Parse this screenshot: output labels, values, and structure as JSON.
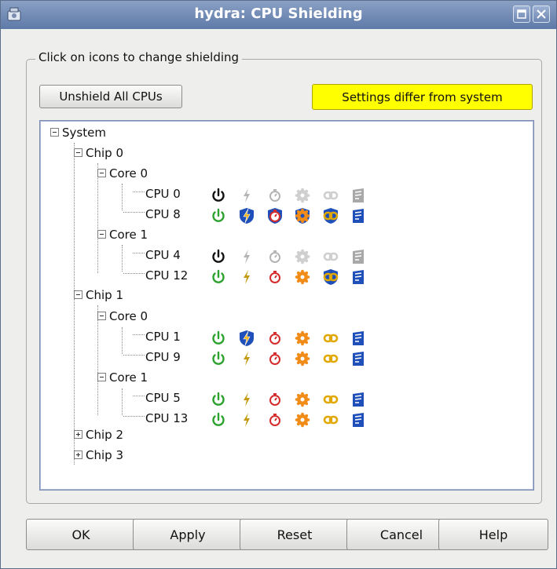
{
  "window": {
    "title": "hydra: CPU Shielding"
  },
  "group": {
    "legend": "Click on icons to change shielding",
    "unshield_label": "Unshield All CPUs",
    "status_text": "Settings differ from system"
  },
  "tree": {
    "root": "System",
    "chips": [
      {
        "label": "Chip 0",
        "cores": [
          {
            "label": "Core 0",
            "cpus": [
              {
                "label": "CPU 0",
                "state": "off"
              },
              {
                "label": "CPU 8",
                "state": "shielded-partial"
              }
            ]
          },
          {
            "label": "Core 1",
            "cpus": [
              {
                "label": "CPU 4",
                "state": "off"
              },
              {
                "label": "CPU 12",
                "state": "active-link-shielded"
              }
            ]
          }
        ]
      },
      {
        "label": "Chip 1",
        "cores": [
          {
            "label": "Core 0",
            "cpus": [
              {
                "label": "CPU 1",
                "state": "active-interrupt-shielded"
              },
              {
                "label": "CPU 9",
                "state": "active"
              }
            ]
          },
          {
            "label": "Core 1",
            "cpus": [
              {
                "label": "CPU 5",
                "state": "active"
              },
              {
                "label": "CPU 13",
                "state": "active"
              }
            ]
          }
        ]
      },
      {
        "label": "Chip 2",
        "collapsed": true
      },
      {
        "label": "Chip 3",
        "collapsed": true
      }
    ],
    "icon_columns": [
      "power-icon",
      "interrupt-icon",
      "timer-icon",
      "process-icon",
      "link-icon",
      "local-timer-icon"
    ]
  },
  "buttons": {
    "ok": "OK",
    "apply": "Apply",
    "reset": "Reset",
    "cancel": "Cancel",
    "help": "Help"
  },
  "colors": {
    "status_background": "#ffff00",
    "shield_blue": "#1f4fb8",
    "active_green": "#2da12d",
    "timer_red": "#d42a2a",
    "process_orange": "#f28c18",
    "link_gold": "#e0a800"
  }
}
